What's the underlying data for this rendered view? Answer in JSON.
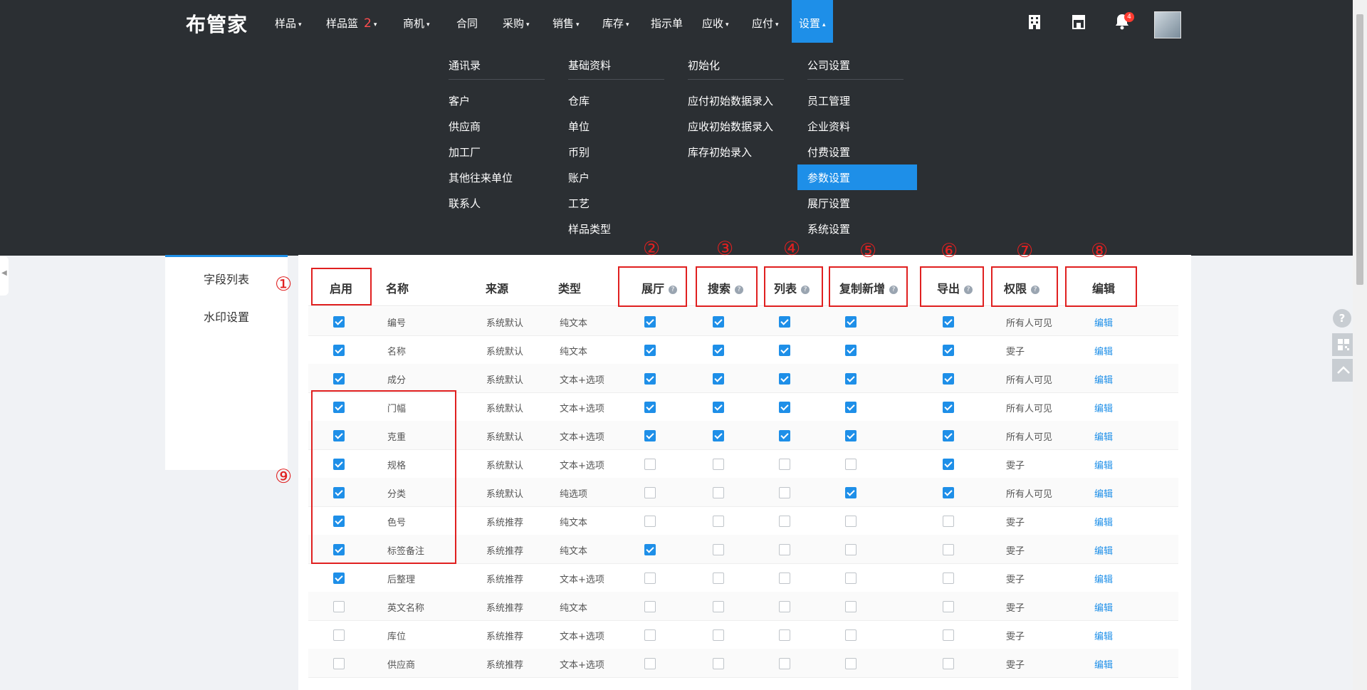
{
  "app": {
    "logo": "布管家"
  },
  "nav": [
    {
      "label": "样品",
      "caret": "▾"
    },
    {
      "label": "样品篮",
      "badge": "2",
      "caret": "▾"
    },
    {
      "label": "商机",
      "caret": "▾"
    },
    {
      "label": "合同",
      "caret": ""
    },
    {
      "label": "采购",
      "caret": "▾"
    },
    {
      "label": "销售",
      "caret": "▾"
    },
    {
      "label": "库存",
      "caret": "▾"
    },
    {
      "label": "指示单",
      "caret": ""
    },
    {
      "label": "应收",
      "caret": "▾"
    },
    {
      "label": "应付",
      "caret": "▾"
    },
    {
      "label": "设置",
      "caret": "▴"
    }
  ],
  "notifications": {
    "count": "4"
  },
  "icons": [
    "building-icon",
    "store-icon",
    "bell-icon"
  ],
  "colors": {
    "accent": "#1e8fe8",
    "topbar": "#2b2f33",
    "annotation": "#e02020"
  },
  "mega_menu": [
    {
      "title": "通讯录",
      "links": [
        "客户",
        "供应商",
        "加工厂",
        "其他往来单位",
        "联系人"
      ]
    },
    {
      "title": "基础资料",
      "links": [
        "仓库",
        "单位",
        "币别",
        "账户",
        "工艺",
        "样品类型"
      ]
    },
    {
      "title": "初始化",
      "links": [
        "应付初始数据录入",
        "应收初始数据录入",
        "库存初始录入"
      ]
    },
    {
      "title": "公司设置",
      "links": [
        "员工管理",
        "企业资料",
        "付费设置",
        "参数设置",
        "展厅设置",
        "系统设置"
      ],
      "active": "参数设置"
    }
  ],
  "sidebar": {
    "items": [
      "字段列表",
      "水印设置"
    ]
  },
  "table": {
    "headers": {
      "enable": "启用",
      "name": "名称",
      "source": "来源",
      "type": "类型",
      "showroom": "展厅",
      "search": "搜索",
      "list": "列表",
      "copy": "复制新增",
      "export": "导出",
      "perm": "权限",
      "edit": "编辑"
    },
    "help_glyph": "?",
    "edit_label": "编辑",
    "rows": [
      {
        "enable": true,
        "name": "编号",
        "source": "系统默认",
        "type": "纯文本",
        "showroom": true,
        "search": true,
        "list": true,
        "copy": true,
        "export": true,
        "perm": "所有人可见"
      },
      {
        "enable": true,
        "name": "名称",
        "source": "系统默认",
        "type": "纯文本",
        "showroom": true,
        "search": true,
        "list": true,
        "copy": true,
        "export": true,
        "perm": "雯子"
      },
      {
        "enable": true,
        "name": "成分",
        "source": "系统默认",
        "type": "文本+选项",
        "showroom": true,
        "search": true,
        "list": true,
        "copy": true,
        "export": true,
        "perm": "所有人可见"
      },
      {
        "enable": true,
        "name": "门幅",
        "source": "系统默认",
        "type": "文本+选项",
        "showroom": true,
        "search": true,
        "list": true,
        "copy": true,
        "export": true,
        "perm": "所有人可见"
      },
      {
        "enable": true,
        "name": "克重",
        "source": "系统默认",
        "type": "文本+选项",
        "showroom": true,
        "search": true,
        "list": true,
        "copy": true,
        "export": true,
        "perm": "所有人可见"
      },
      {
        "enable": true,
        "name": "规格",
        "source": "系统默认",
        "type": "文本+选项",
        "showroom": false,
        "search": false,
        "list": false,
        "copy": false,
        "export": true,
        "perm": "雯子"
      },
      {
        "enable": true,
        "name": "分类",
        "source": "系统默认",
        "type": "纯选项",
        "showroom": false,
        "search": false,
        "list": false,
        "copy": true,
        "export": true,
        "perm": "所有人可见"
      },
      {
        "enable": true,
        "name": "色号",
        "source": "系统推荐",
        "type": "纯文本",
        "showroom": false,
        "search": false,
        "list": false,
        "copy": false,
        "export": false,
        "perm": "雯子"
      },
      {
        "enable": true,
        "name": "标签备注",
        "source": "系统推荐",
        "type": "纯文本",
        "showroom": true,
        "search": false,
        "list": false,
        "copy": false,
        "export": false,
        "perm": "雯子"
      },
      {
        "enable": true,
        "name": "后整理",
        "source": "系统推荐",
        "type": "文本+选项",
        "showroom": false,
        "search": false,
        "list": false,
        "copy": false,
        "export": false,
        "perm": "雯子"
      },
      {
        "enable": false,
        "name": "英文名称",
        "source": "系统推荐",
        "type": "纯文本",
        "showroom": false,
        "search": false,
        "list": false,
        "copy": false,
        "export": false,
        "perm": "雯子"
      },
      {
        "enable": false,
        "name": "库位",
        "source": "系统推荐",
        "type": "文本+选项",
        "showroom": false,
        "search": false,
        "list": false,
        "copy": false,
        "export": false,
        "perm": "雯子"
      },
      {
        "enable": false,
        "name": "供应商",
        "source": "系统推荐",
        "type": "文本+选项",
        "showroom": false,
        "search": false,
        "list": false,
        "copy": false,
        "export": false,
        "perm": "雯子"
      }
    ]
  },
  "annotations": [
    "①",
    "②",
    "③",
    "④",
    "⑤",
    "⑥",
    "⑦",
    "⑧",
    "⑨"
  ],
  "float_buttons": [
    "help-icon",
    "qrcode-icon",
    "back-to-top-icon"
  ]
}
